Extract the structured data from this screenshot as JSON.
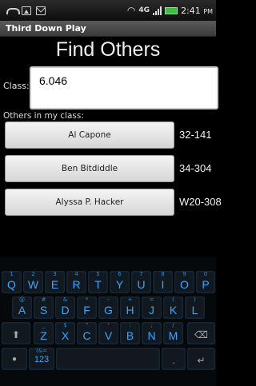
{
  "status_bar": {
    "time": "2:41",
    "time_suffix": "PM",
    "network": "4G"
  },
  "app": {
    "title": "Third Down Play"
  },
  "screen": {
    "heading": "Find Others",
    "class_label": "Class:",
    "class_value": "6.046",
    "others_label": "Others in my class:"
  },
  "people": [
    {
      "name": "Al Capone",
      "room": "32-141"
    },
    {
      "name": "Ben Bitdiddle",
      "room": "34-304"
    },
    {
      "name": "Alyssa P. Hacker",
      "room": "W20-308"
    }
  ],
  "keyboard": {
    "row1": [
      "Q",
      "W",
      "E",
      "R",
      "T",
      "Y",
      "U",
      "I",
      "O",
      "P"
    ],
    "row1_nums": [
      "1",
      "2",
      "3",
      "4",
      "5",
      "6",
      "7",
      "8",
      "9",
      "0"
    ],
    "row2": [
      "A",
      "S",
      "D",
      "F",
      "G",
      "H",
      "J",
      "K",
      "L"
    ],
    "row2_alts": [
      "@",
      "#",
      "&",
      "*",
      "-",
      "+",
      "=",
      "(",
      ")"
    ],
    "row3": [
      "Z",
      "X",
      "C",
      "V",
      "B",
      "N",
      "M"
    ],
    "row3_alts": [
      "_",
      "$",
      "\"",
      "'",
      ":",
      ";",
      "/"
    ],
    "sym_key": "123",
    "sym_alt": "(&=",
    "colors": {
      "key_text": "#36a8ff",
      "key_bg": "#12181f"
    }
  }
}
